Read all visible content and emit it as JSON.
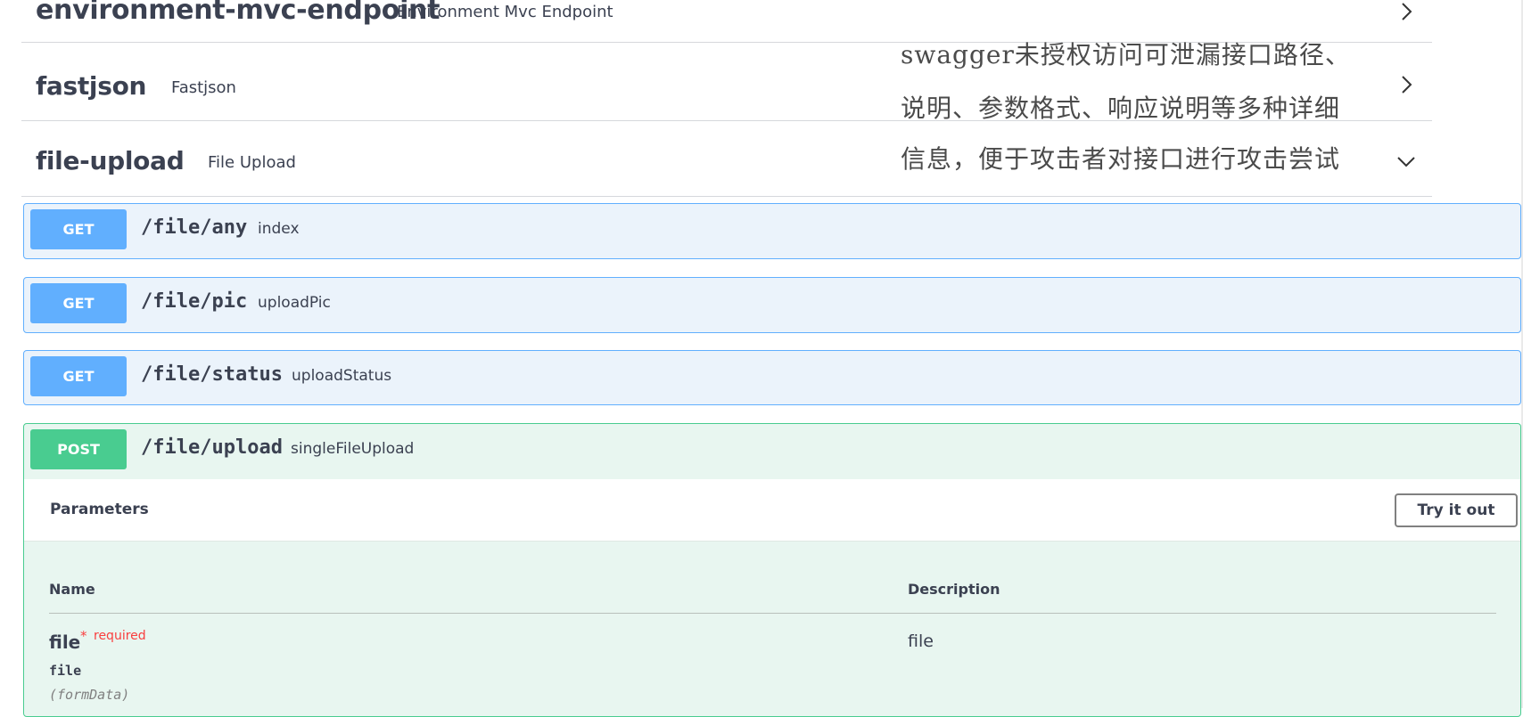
{
  "tags": [
    {
      "name": "environment-mvc-endpoint",
      "description": "Environment Mvc Endpoint",
      "state": "collapsed",
      "icon": "chevron-right-icon"
    },
    {
      "name": "fastjson",
      "description": "Fastjson",
      "state": "collapsed",
      "icon": "chevron-right-icon"
    },
    {
      "name": "file-upload",
      "description": "File Upload",
      "state": "expanded",
      "icon": "chevron-down-icon"
    }
  ],
  "operations": [
    {
      "method": "GET",
      "path": "/file/any",
      "summary": "index"
    },
    {
      "method": "GET",
      "path": "/file/pic",
      "summary": "uploadPic"
    },
    {
      "method": "GET",
      "path": "/file/status",
      "summary": "uploadStatus"
    },
    {
      "method": "POST",
      "path": "/file/upload",
      "summary": "singleFileUpload"
    }
  ],
  "parameters": {
    "title": "Parameters",
    "try_button": "Try it out",
    "columns": {
      "name": "Name",
      "description": "Description"
    },
    "rows": [
      {
        "name": "file",
        "required_mark": "*",
        "required_label": "required",
        "type": "file",
        "location": "(formData)",
        "description": "file"
      }
    ]
  },
  "annotation": {
    "lines": [
      "swagger未授权访问可泄漏接口路径、",
      "说明、参数格式、响应说明等多种详细",
      "信息，便于攻击者对接口进行攻击尝试"
    ]
  },
  "colors": {
    "get": "#61affe",
    "post": "#49cc90",
    "get_bg": "#ebf3fb",
    "post_bg": "#e8f6f0",
    "required": "#f93e3e"
  }
}
